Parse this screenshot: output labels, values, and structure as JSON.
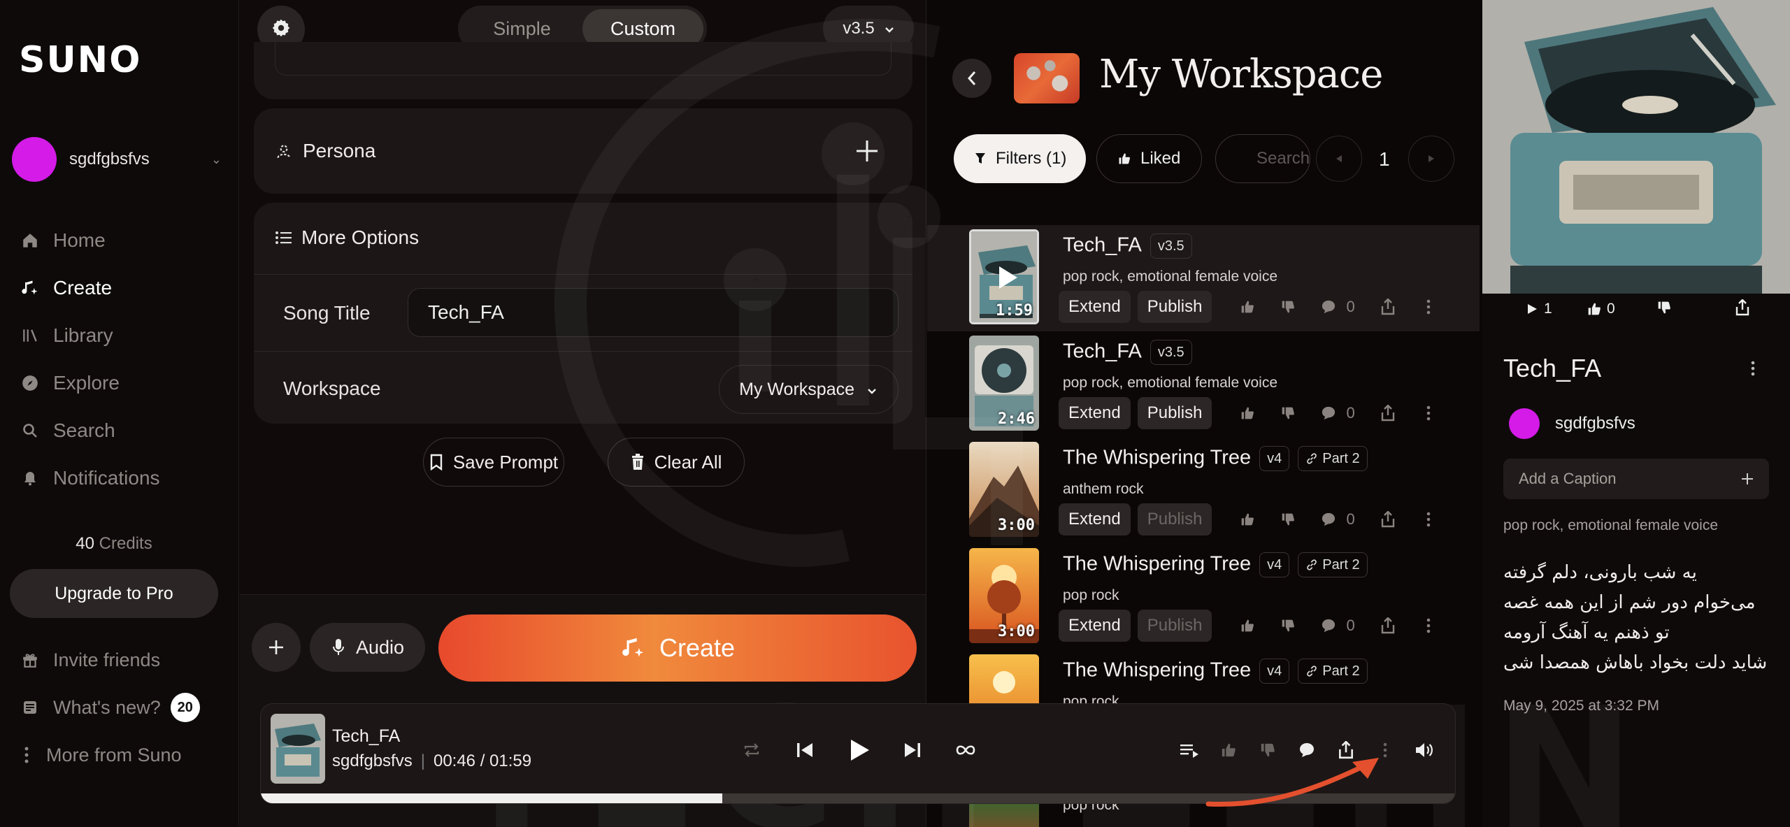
{
  "brand": {
    "logo": "SUNO"
  },
  "sidebar": {
    "user": {
      "name": "sgdfgbsfvs",
      "avatar_color": "#d41be8"
    },
    "nav": [
      {
        "label": "Home",
        "icon": "home-icon"
      },
      {
        "label": "Create",
        "icon": "create-music-icon",
        "active": true
      },
      {
        "label": "Library",
        "icon": "library-icon"
      },
      {
        "label": "Explore",
        "icon": "compass-icon"
      },
      {
        "label": "Search",
        "icon": "search-icon"
      },
      {
        "label": "Notifications",
        "icon": "bell-icon"
      }
    ],
    "credits_value": "40",
    "credits_label": "Credits",
    "upgrade_label": "Upgrade to Pro",
    "bottom_nav": [
      {
        "label": "Invite friends",
        "icon": "gift-icon"
      },
      {
        "label": "What's new?",
        "icon": "news-icon",
        "badge": "20"
      },
      {
        "label": "More from Suno",
        "icon": "more-vertical-icon"
      }
    ]
  },
  "create": {
    "mode_simple": "Simple",
    "mode_custom": "Custom",
    "active_mode": "Custom",
    "version": "v3.5",
    "persona_label": "Persona",
    "more_options_label": "More Options",
    "song_title_label": "Song Title",
    "song_title_value": "Tech_FA",
    "workspace_label": "Workspace",
    "workspace_value": "My Workspace",
    "save_prompt_label": "Save Prompt",
    "clear_all_label": "Clear All",
    "audio_label": "Audio",
    "create_label": "Create",
    "accent_gradient": [
      "#e8492c",
      "#f08a3c"
    ]
  },
  "workspace": {
    "title": "My Workspace",
    "filters_label": "Filters (1)",
    "liked_label": "Liked",
    "search_placeholder": "Search",
    "page_number": "1",
    "songs": [
      {
        "title": "Tech_FA",
        "version": "v3.5",
        "style": "pop rock, emotional female voice",
        "duration": "1:59",
        "extend": "Extend",
        "publish": "Publish",
        "publish_enabled": true,
        "comments": "0",
        "selected": true,
        "thumb": "turntable",
        "playing_overlay": true
      },
      {
        "title": "Tech_FA",
        "version": "v3.5",
        "style": "pop rock, emotional female voice",
        "duration": "2:46",
        "extend": "Extend",
        "publish": "Publish",
        "publish_enabled": true,
        "comments": "0",
        "thumb": "turntable2"
      },
      {
        "title": "The Whispering Tree",
        "version": "v4",
        "part": "Part 2",
        "style": "anthem rock",
        "duration": "3:00",
        "extend": "Extend",
        "publish": "Publish",
        "publish_enabled": false,
        "comments": "0",
        "thumb": "mountain"
      },
      {
        "title": "The Whispering Tree",
        "version": "v4",
        "part": "Part 2",
        "style": "pop rock",
        "duration": "3:00",
        "extend": "Extend",
        "publish": "Publish",
        "publish_enabled": false,
        "comments": "0",
        "thumb": "tree"
      },
      {
        "title": "The Whispering Tree",
        "version": "v4",
        "part": "Part 2",
        "style": "pop rock",
        "duration": "",
        "thumb": "sunset"
      }
    ],
    "partial_row_style": "pop rock"
  },
  "detail": {
    "plays": "1",
    "likes": "0",
    "title": "Tech_FA",
    "user": "sgdfgbsfvs",
    "caption_placeholder": "Add a Caption",
    "style": "pop rock, emotional female voice",
    "lyrics": [
      "یه شب بارونی، دلم گرفته",
      "می‌خوام دور شم از این همه غصه",
      "تو ذهنم یه آهنگ آرومه",
      "شاید دلت بخواد باهاش همصدا شی"
    ],
    "date": "May 9, 2025 at 3:32 PM"
  },
  "player": {
    "title": "Tech_FA",
    "artist": "sgdfgbsfvs",
    "current_time": "00:46",
    "total_time": "01:59",
    "progress_fraction": 0.386
  },
  "watermark": "TECH ZEHN"
}
